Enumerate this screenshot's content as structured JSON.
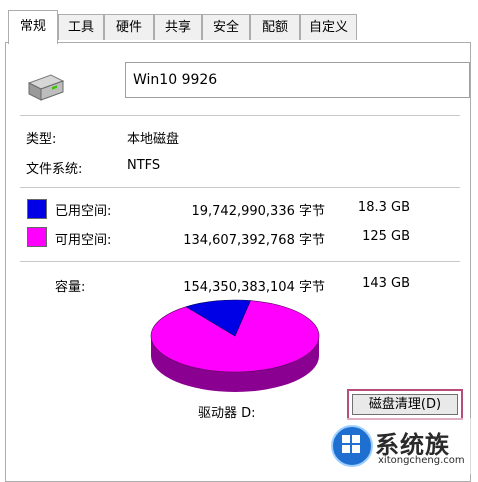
{
  "tabs": [
    {
      "label": "常规",
      "active": true
    },
    {
      "label": "工具"
    },
    {
      "label": "硬件"
    },
    {
      "label": "共享"
    },
    {
      "label": "安全"
    },
    {
      "label": "配额"
    },
    {
      "label": "自定义"
    }
  ],
  "drive": {
    "icon": "hard-drive-icon",
    "name": "Win10 9926"
  },
  "info": {
    "type_label": "类型:",
    "type_value": "本地磁盘",
    "fs_label": "文件系统:",
    "fs_value": "NTFS"
  },
  "usage": {
    "used": {
      "label": "已用空间:",
      "bytes": "19,742,990,336 字节",
      "size": "18.3 GB",
      "color": "#0000e6"
    },
    "free": {
      "label": "可用空间:",
      "bytes": "134,607,392,768 字节",
      "size": "125 GB",
      "color": "#ff00ff"
    },
    "capacity": {
      "label": "容量:",
      "bytes": "154,350,383,104 字节",
      "size": "143 GB"
    }
  },
  "pie": {
    "used_fraction": 0.128,
    "used_color": "#0000e6",
    "free_color": "#ff00ff",
    "free_side_color": "#8a0090",
    "used_side_color": "#000080"
  },
  "drive_label": "驱动器 D:",
  "cleanup_button": "磁盘清理(D)",
  "watermark": {
    "title": "系统族",
    "url": "xitongcheng.com"
  }
}
